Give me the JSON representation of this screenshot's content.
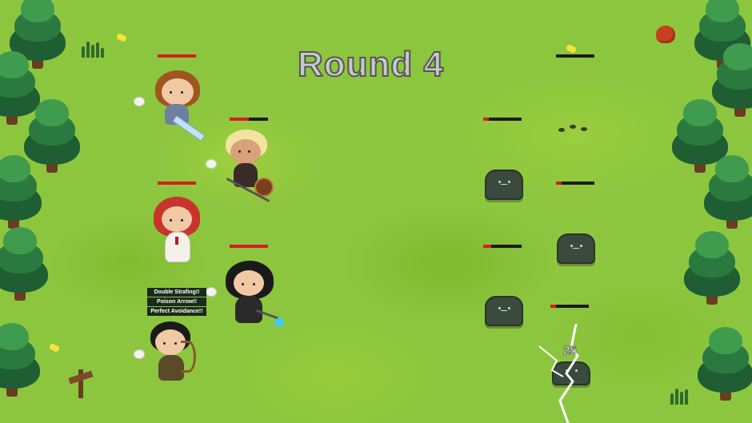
{
  "round": {
    "label": "Round 4"
  },
  "skills": [
    "Double Strafing!!",
    "Poison Arrow!!",
    "Perfect Avoidance!!"
  ],
  "damage_text": "25",
  "heroes": [
    {
      "name": "knight",
      "hp": 1.0
    },
    {
      "name": "warrior",
      "hp": 0.5
    },
    {
      "name": "priest",
      "hp": 1.0
    },
    {
      "name": "mage",
      "hp": 1.0
    },
    {
      "name": "archer",
      "hp": 1.0
    }
  ],
  "enemies": [
    {
      "name": "slime-1",
      "hp": 0.0
    },
    {
      "name": "slime-2",
      "hp": 0.15
    },
    {
      "name": "slime-3",
      "hp": 0.15
    },
    {
      "name": "slime-4",
      "hp": 0.2
    },
    {
      "name": "slime-5",
      "hp": 0.15
    }
  ],
  "colors": {
    "grass": "#8cc63f",
    "hp_fill": "#d42020",
    "hp_back": "#1a1a1a"
  }
}
